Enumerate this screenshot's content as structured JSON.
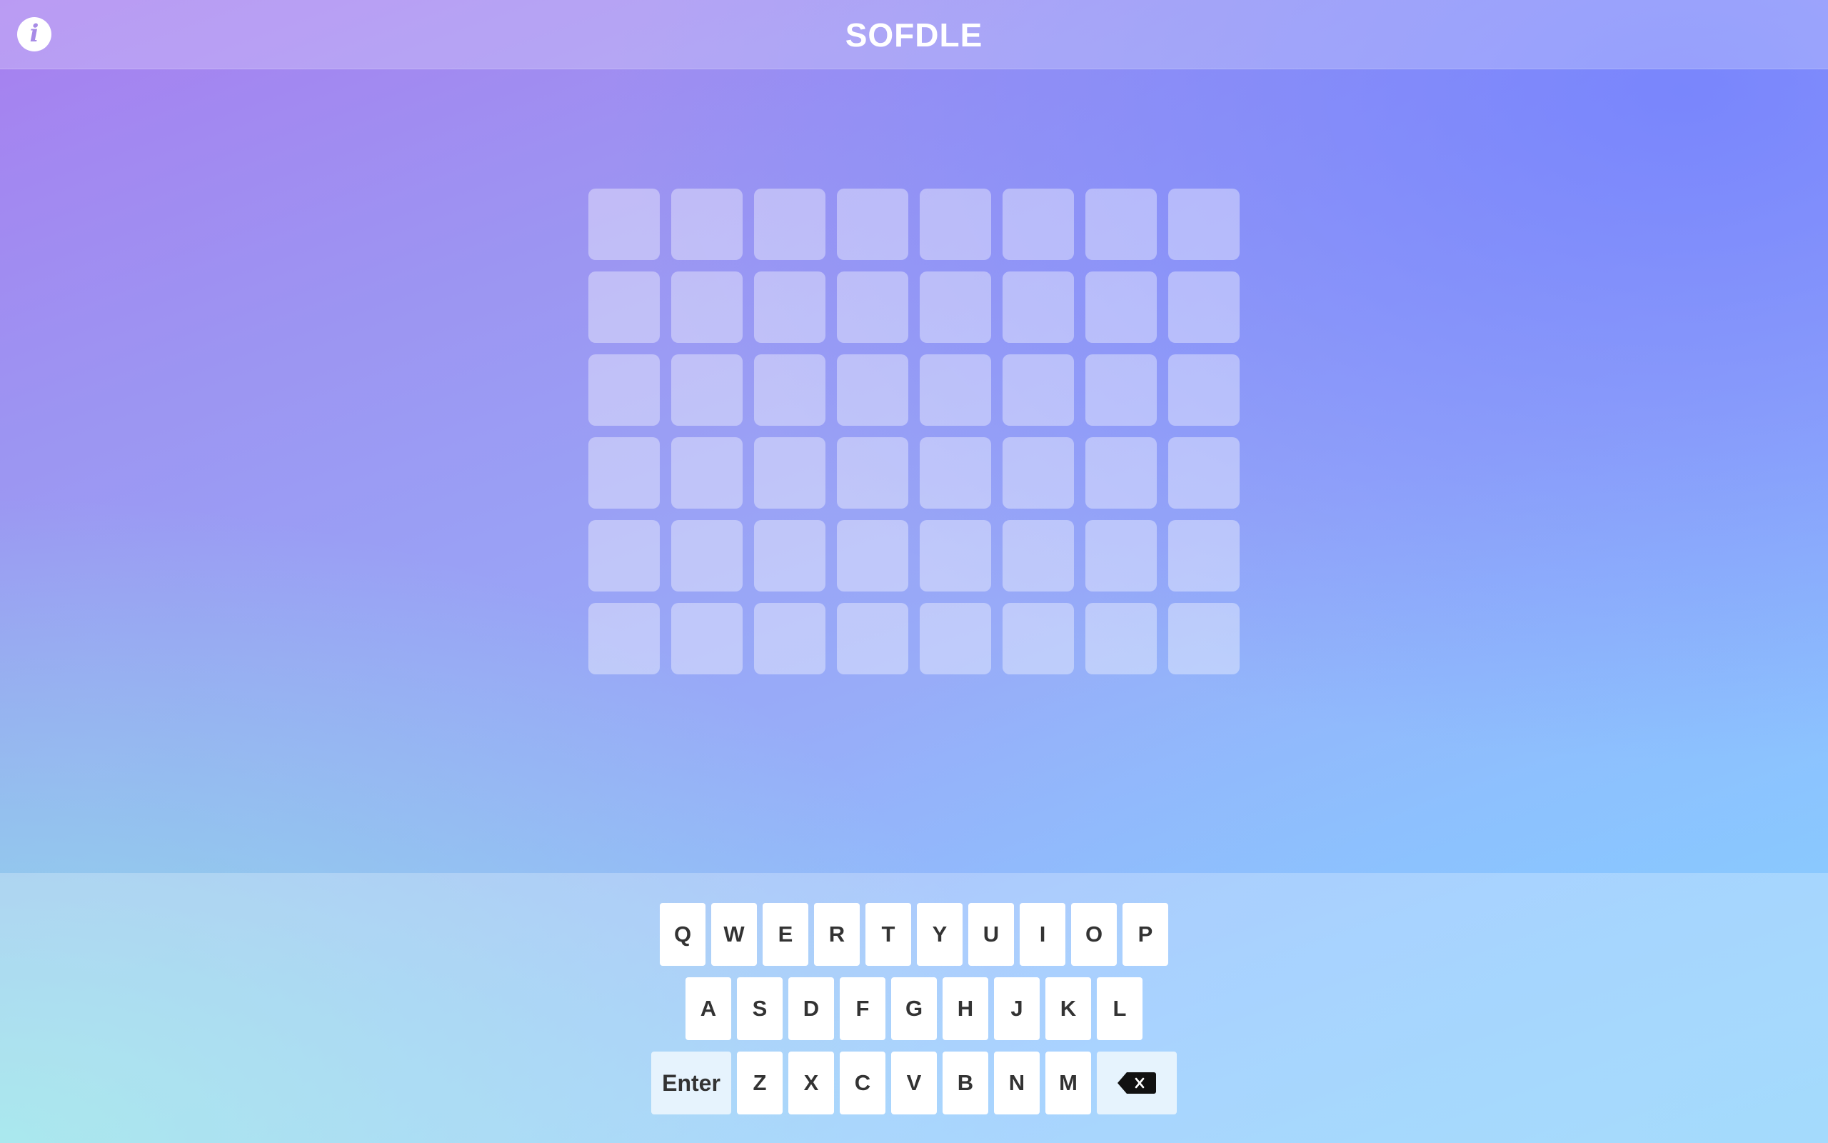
{
  "header": {
    "title": "SOFDLE",
    "info_icon": "info-icon"
  },
  "board": {
    "rows": 6,
    "columns": 8,
    "tiles": [
      [
        "",
        "",
        "",
        "",
        "",
        "",
        "",
        ""
      ],
      [
        "",
        "",
        "",
        "",
        "",
        "",
        "",
        ""
      ],
      [
        "",
        "",
        "",
        "",
        "",
        "",
        "",
        ""
      ],
      [
        "",
        "",
        "",
        "",
        "",
        "",
        "",
        ""
      ],
      [
        "",
        "",
        "",
        "",
        "",
        "",
        "",
        ""
      ],
      [
        "",
        "",
        "",
        "",
        "",
        "",
        "",
        ""
      ]
    ]
  },
  "keyboard": {
    "row1": [
      "Q",
      "W",
      "E",
      "R",
      "T",
      "Y",
      "U",
      "I",
      "O",
      "P"
    ],
    "row2": [
      "A",
      "S",
      "D",
      "F",
      "G",
      "H",
      "J",
      "K",
      "L"
    ],
    "row3": [
      "Z",
      "X",
      "C",
      "V",
      "B",
      "N",
      "M"
    ],
    "enter_label": "Enter",
    "backspace_icon": "backspace-icon"
  },
  "colors": {
    "tile_empty": "rgba(255,255,255,0.38)",
    "key_bg": "#ffffff",
    "special_key_bg": "#e6f3fd",
    "key_text": "#333333"
  }
}
